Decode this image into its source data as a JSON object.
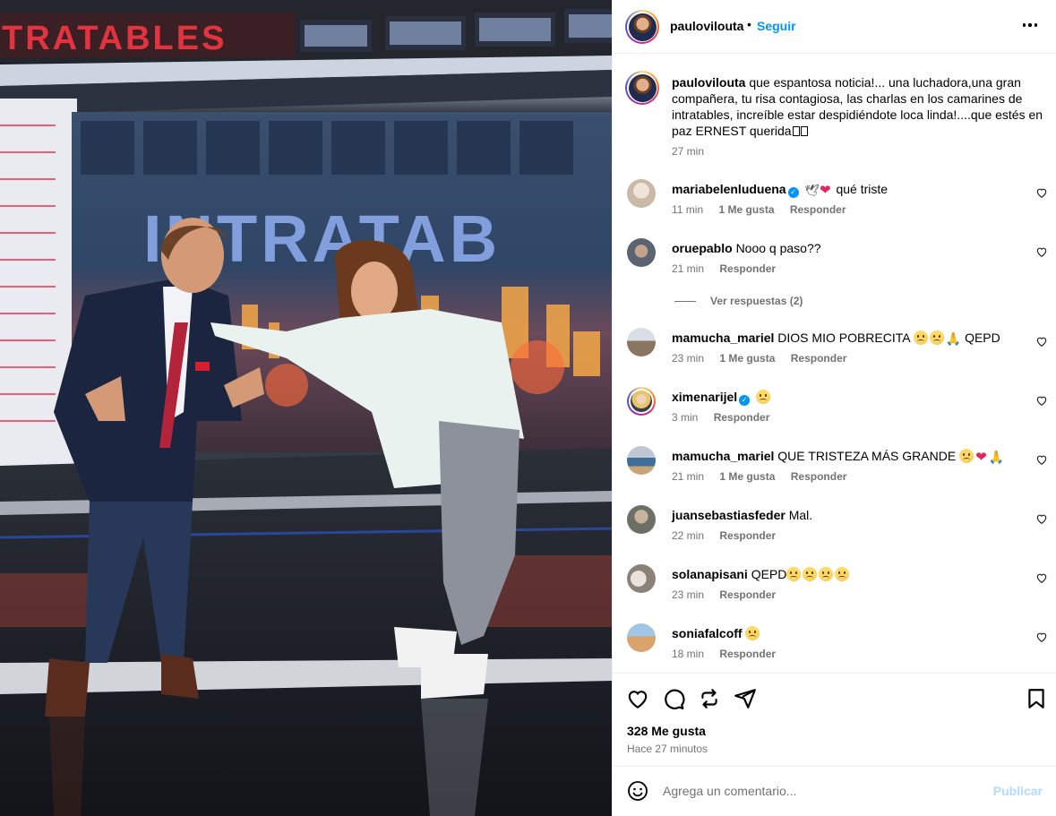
{
  "post": {
    "username": "paulovilouta",
    "dot": "•",
    "follow_label": "Seguir",
    "caption_user": "paulovilouta",
    "caption_text": "que espantosa noticia!... una luchadora,una gran compañera, tu risa contagiosa, las charlas en los camarines de intratables, increíble estar despidiéndote loca linda!....que estés en paz ERNEST querida",
    "caption_time": "27 min"
  },
  "photo": {
    "sign_text": "TRATABLES",
    "screen_text": "INTRATAB"
  },
  "comments": [
    {
      "user": "mariabelenluduena",
      "verified": true,
      "text": "qué triste",
      "time": "11 min",
      "likes": "1 Me gusta",
      "reply": "Responder"
    },
    {
      "user": "oruepablo",
      "verified": false,
      "text": "Nooo q paso??",
      "time": "21 min",
      "likes": "",
      "reply": "Responder"
    },
    {
      "user": "mamucha_mariel",
      "verified": false,
      "text": "DIOS MIO POBRECITA",
      "suffix": "QEPD",
      "time": "23 min",
      "likes": "1 Me gusta",
      "reply": "Responder"
    },
    {
      "user": "ximenarijel",
      "verified": true,
      "text": "",
      "time": "3 min",
      "likes": "",
      "reply": "Responder"
    },
    {
      "user": "mamucha_mariel",
      "verified": false,
      "text": "QUE TRISTEZA MÁS GRANDE",
      "time": "21 min",
      "likes": "1 Me gusta",
      "reply": "Responder"
    },
    {
      "user": "juansebastiasfeder",
      "verified": false,
      "text": "Mal.",
      "time": "22 min",
      "likes": "",
      "reply": "Responder"
    },
    {
      "user": "solanapisani",
      "verified": false,
      "text": "QEPD",
      "time": "23 min",
      "likes": "",
      "reply": "Responder"
    },
    {
      "user": "soniafalcoff",
      "verified": false,
      "text": "",
      "time": "18 min",
      "likes": "",
      "reply": "Responder"
    }
  ],
  "view_replies": "Ver respuestas (2)",
  "actions": {
    "likes_count": "328 Me gusta",
    "posted_ago": "Hace 27 minutos"
  },
  "add_comment": {
    "placeholder": "Agrega un comentario...",
    "publish_label": "Publicar"
  },
  "colors": {
    "accent": "#0095f6",
    "publish_disabled": "#b3dbff",
    "muted": "#737373"
  }
}
